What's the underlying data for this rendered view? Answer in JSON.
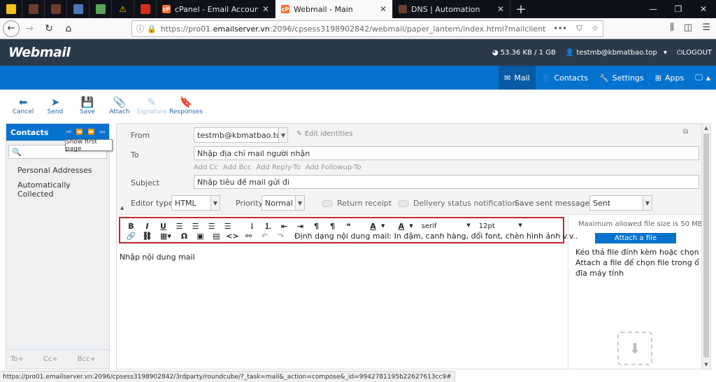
{
  "browser": {
    "tabs": [
      {
        "label": "cPanel - Email Accounts"
      },
      {
        "label": "Webmail - Main"
      },
      {
        "label": "DNS | Automation"
      }
    ],
    "url": {
      "prefix": "https://pro01.",
      "host": "emailserver.vn",
      "rest": ":2096/cpsess3198902842/webmail/paper_lantern/index.html?mailclient=roundcube"
    },
    "status_url": "https://pro01.emailserver.vn:2096/cpsess3198902842/3rdparty/roundcube/?_task=mail&_action=compose&_id=9942781195b22627613cc9#"
  },
  "header": {
    "logo": "Webmail",
    "quota": "53.36 KB / 1 GB",
    "user": "testmb@kbmatbao.top",
    "logout": "LOGOUT"
  },
  "nav": {
    "mail": "Mail",
    "contacts": "Contacts",
    "settings": "Settings",
    "apps": "Apps"
  },
  "toolbar": {
    "cancel": "Cancel",
    "send": "Send",
    "save": "Save",
    "attach": "Attach",
    "signature": "Signature",
    "responses": "Responses"
  },
  "sidebar": {
    "title": "Contacts",
    "tooltip": "Show first page",
    "items": [
      "Personal Addresses",
      "Automatically Collected"
    ],
    "footer": [
      "To+",
      "Cc+",
      "Bcc+"
    ]
  },
  "compose": {
    "from_label": "From",
    "from_value": "testmb@kbmatbao.top",
    "edit_identities": "Edit identities",
    "to_label": "To",
    "to_value": "Nhập địa chỉ mail người nhận",
    "links": [
      "Add Cc",
      "Add Bcc",
      "Add Reply-To",
      "Add Followup-To"
    ],
    "subject_label": "Subject",
    "subject_value": "Nhập tiêu đề mail gửi đi",
    "editor_type_label": "Editor type",
    "editor_type_value": "HTML",
    "priority_label": "Priority",
    "priority_value": "Normal",
    "return_receipt": "Return receipt",
    "delivery_status": "Delivery status notification",
    "save_sent_label": "Save sent message in",
    "save_sent_value": "Sent",
    "font_family": "serif",
    "font_size": "12pt",
    "format_hint": "Định dạng nội dung mail: In đậm, canh hàng, đổi font, chèn hình ảnh v.v..",
    "body": "Nhập nội dung mail"
  },
  "attachments": {
    "max_size": "Maximum allowed file size is 50 MB",
    "button": "Attach a file",
    "hint": "Kéo thả file đính kèm hoặc chọn Attach a file để chọn file trong ổ đĩa máy tính"
  },
  "colors": {
    "brand_blue": "#0572ce",
    "header_dark": "#293a4a",
    "highlight_red": "#c0282d"
  }
}
